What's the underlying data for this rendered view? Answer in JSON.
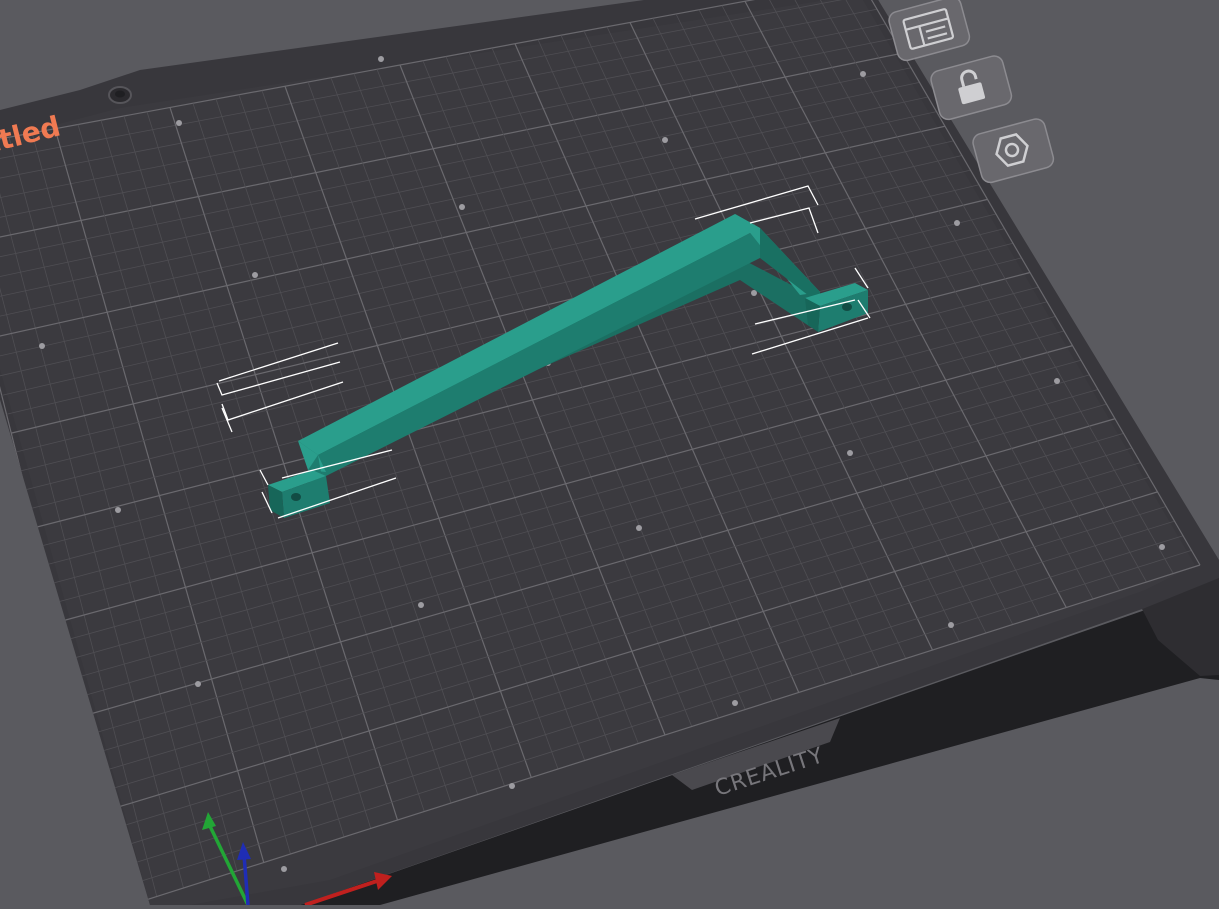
{
  "plate": {
    "label": "ttled",
    "brand_logo": "CREALITY"
  },
  "toolbar": {
    "buttons": [
      {
        "name": "arrange-button",
        "icon": "layout-icon"
      },
      {
        "name": "lock-button",
        "icon": "unlock-icon"
      },
      {
        "name": "plate-settings-button",
        "icon": "hex-nut-icon"
      }
    ]
  },
  "colors": {
    "background": "#5a5a5f",
    "bed": "#38373c",
    "model": "#2a9e8c",
    "label": "#f07a52",
    "axis_x": "#c0201e",
    "axis_y": "#22a636",
    "axis_z": "#1f2db5"
  }
}
